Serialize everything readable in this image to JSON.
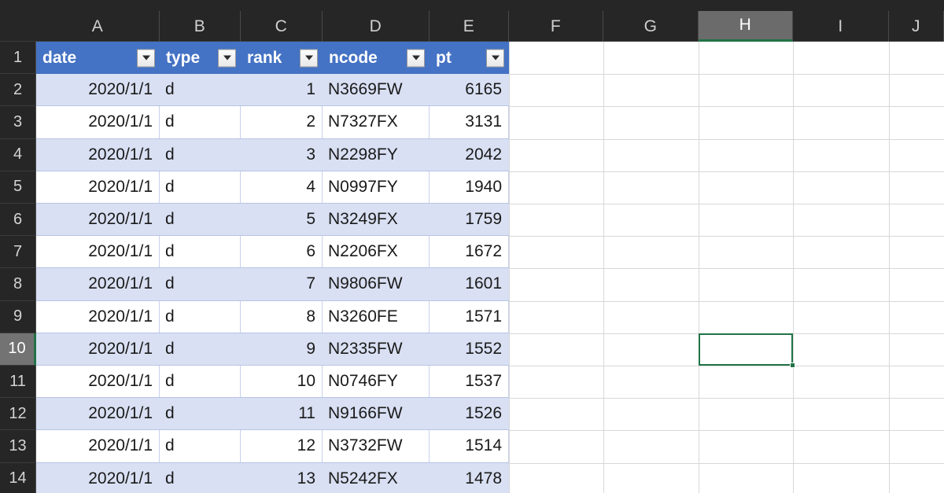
{
  "app": {
    "type": "spreadsheet",
    "active_cell": "H10",
    "accent_green": "#217346",
    "header_blue": "#4472C4",
    "band_color": "#d9e0f3",
    "grid_line": "#d8d8d8"
  },
  "columns": {
    "letters": [
      "A",
      "B",
      "C",
      "D",
      "E",
      "F",
      "G",
      "H",
      "I",
      "J"
    ],
    "active_letter": "H"
  },
  "rows": {
    "numbers": [
      "1",
      "2",
      "3",
      "4",
      "5",
      "6",
      "7",
      "8",
      "9",
      "10",
      "11",
      "12",
      "13",
      "14"
    ],
    "active_number": "10"
  },
  "corner": {
    "icon": "select-all-triangle-icon"
  },
  "table": {
    "headers": [
      "date",
      "type",
      "rank",
      "ncode",
      "pt"
    ],
    "filter_icon": "filter-dropdown-arrow-icon",
    "rows": [
      {
        "date": "2020/1/1",
        "type": "d",
        "rank": "1",
        "ncode": "N3669FW",
        "pt": "6165"
      },
      {
        "date": "2020/1/1",
        "type": "d",
        "rank": "2",
        "ncode": "N7327FX",
        "pt": "3131"
      },
      {
        "date": "2020/1/1",
        "type": "d",
        "rank": "3",
        "ncode": "N2298FY",
        "pt": "2042"
      },
      {
        "date": "2020/1/1",
        "type": "d",
        "rank": "4",
        "ncode": "N0997FY",
        "pt": "1940"
      },
      {
        "date": "2020/1/1",
        "type": "d",
        "rank": "5",
        "ncode": "N3249FX",
        "pt": "1759"
      },
      {
        "date": "2020/1/1",
        "type": "d",
        "rank": "6",
        "ncode": "N2206FX",
        "pt": "1672"
      },
      {
        "date": "2020/1/1",
        "type": "d",
        "rank": "7",
        "ncode": "N9806FW",
        "pt": "1601"
      },
      {
        "date": "2020/1/1",
        "type": "d",
        "rank": "8",
        "ncode": "N3260FE",
        "pt": "1571"
      },
      {
        "date": "2020/1/1",
        "type": "d",
        "rank": "9",
        "ncode": "N2335FW",
        "pt": "1552"
      },
      {
        "date": "2020/1/1",
        "type": "d",
        "rank": "10",
        "ncode": "N0746FY",
        "pt": "1537"
      },
      {
        "date": "2020/1/1",
        "type": "d",
        "rank": "11",
        "ncode": "N9166FW",
        "pt": "1526"
      },
      {
        "date": "2020/1/1",
        "type": "d",
        "rank": "12",
        "ncode": "N3732FW",
        "pt": "1514"
      },
      {
        "date": "2020/1/1",
        "type": "d",
        "rank": "13",
        "ncode": "N5242FX",
        "pt": "1478"
      }
    ]
  }
}
